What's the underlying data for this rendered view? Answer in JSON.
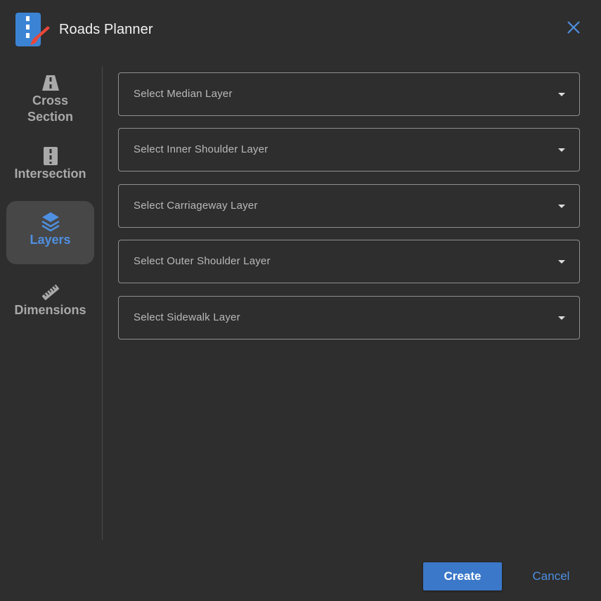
{
  "app": {
    "title": "Roads Planner",
    "logo_icon": "roads-planner-logo-icon",
    "close_icon": "close-icon"
  },
  "colors": {
    "background": "#2e2e2e",
    "accent": "#4f8fe0",
    "primary_button": "#3b78c9",
    "logo_blue": "#3b84d4",
    "logo_brush": "#e8473a",
    "nav_text": "#a9a9a9",
    "active_nav_bg": "#474747"
  },
  "sidebar": {
    "items": [
      {
        "label": "Cross Section",
        "icon": "road-icon",
        "active": false
      },
      {
        "label": "Intersection",
        "icon": "road-lane-icon",
        "active": false
      },
      {
        "label": "Layers",
        "icon": "layers-icon",
        "active": true
      },
      {
        "label": "Dimensions",
        "icon": "ruler-icon",
        "active": false
      }
    ]
  },
  "selects": [
    {
      "placeholder": "Select Median Layer"
    },
    {
      "placeholder": "Select Inner Shoulder Layer"
    },
    {
      "placeholder": "Select Carriageway Layer"
    },
    {
      "placeholder": "Select Outer Shoulder Layer"
    },
    {
      "placeholder": "Select Sidewalk Layer"
    }
  ],
  "footer": {
    "create_label": "Create",
    "cancel_label": "Cancel"
  }
}
